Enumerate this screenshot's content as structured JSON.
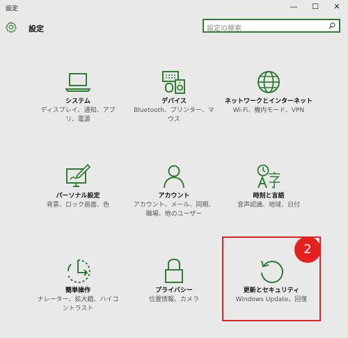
{
  "window": {
    "title": "設定",
    "minimize": "—",
    "maximize": "☐",
    "close": "✕"
  },
  "header": {
    "title": "設定",
    "icon": "gear-icon"
  },
  "search": {
    "placeholder": "設定の検索",
    "icon": "search-icon"
  },
  "tiles": [
    {
      "label": "システム",
      "desc": "ディスプレイ、通知、アプリ、電源",
      "icon": "laptop-icon"
    },
    {
      "label": "デバイス",
      "desc": "Bluetooth、プリンター、マウス",
      "icon": "devices-icon"
    },
    {
      "label": "ネットワークとインターネット",
      "desc": "Wi-Fi、機内モード、VPN",
      "icon": "globe-icon"
    },
    {
      "label": "パーソナル設定",
      "desc": "背景、ロック画面、色",
      "icon": "personalization-icon"
    },
    {
      "label": "アカウント",
      "desc": "アカウント、メール、同期、職場、他のユーザー",
      "icon": "person-icon"
    },
    {
      "label": "時刻と言語",
      "desc": "音声認識、地域、日付",
      "icon": "time-language-icon"
    },
    {
      "label": "簡単操作",
      "desc": "ナレーター、拡大鏡、ハイコントラスト",
      "icon": "ease-of-access-icon"
    },
    {
      "label": "プライバシー",
      "desc": "位置情報、カメラ",
      "icon": "lock-icon"
    },
    {
      "label": "更新とセキュリティ",
      "desc": "Windows Update、回復",
      "icon": "update-icon"
    }
  ],
  "annotation": {
    "badge": "2",
    "color": "#e52020"
  },
  "accent": "#2e7d32"
}
